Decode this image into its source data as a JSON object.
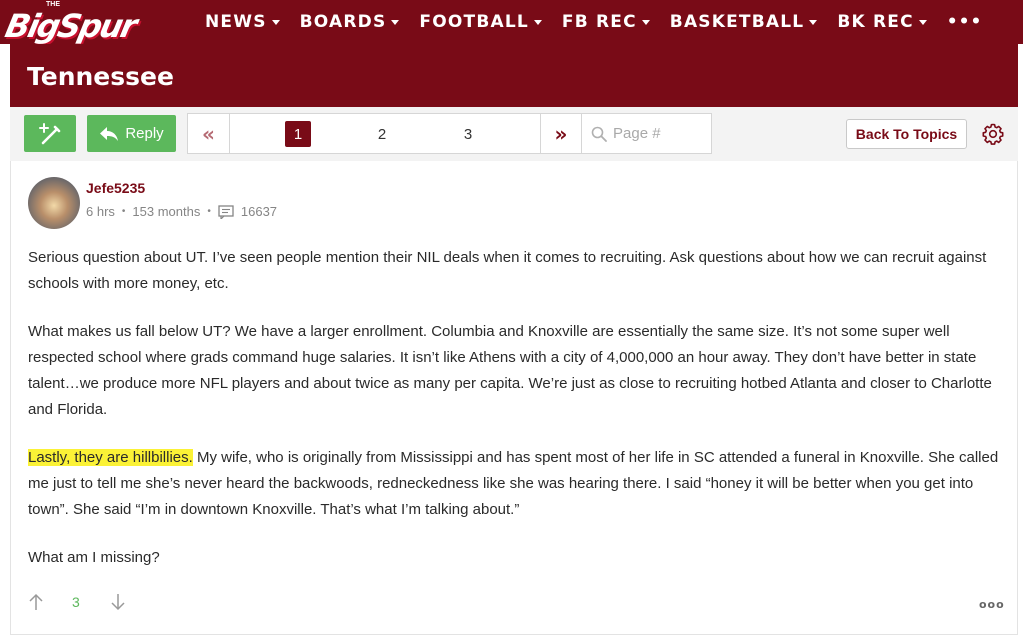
{
  "brand": {
    "logo_main": "BigSpur",
    "logo_the": "THE"
  },
  "nav": {
    "items": [
      {
        "label": "NEWS"
      },
      {
        "label": "BOARDS"
      },
      {
        "label": "FOOTBALL"
      },
      {
        "label": "FB REC"
      },
      {
        "label": "BASKETBALL"
      },
      {
        "label": "BK REC"
      }
    ],
    "more": "•••"
  },
  "page": {
    "title": "Tennessee"
  },
  "toolbar": {
    "new_topic_icon": "wand-plus-icon",
    "reply_label": "Reply",
    "pages": [
      "1",
      "2",
      "3"
    ],
    "current_page": "1",
    "page_placeholder": "Page #",
    "back_label": "Back To Topics",
    "settings_icon": "gear-icon"
  },
  "post": {
    "username": "Jefe5235",
    "time": "6 hrs",
    "tenure": "153 months",
    "post_count": "16637",
    "paragraphs": {
      "p1": "Serious question about UT. I’ve seen people mention their NIL deals when it comes to recruiting. Ask questions about how we can recruit against schools with more money, etc.",
      "p2": "What makes us fall below UT? We have a larger enrollment. Columbia and Knoxville are essentially the same size. It’s not some super well respected school where grads command huge salaries. It isn’t like Athens with a city of 4,000,000 an hour away. They don’t have better in state talent…we produce more NFL players and about twice as many per capita. We’re just as close to recruiting hotbed Atlanta and closer to Charlotte and Florida.",
      "p3_highlight": "Lastly, they are hillbillies.",
      "p3_rest": " My wife, who is originally from Mississippi and has spent most of her life in SC attended a funeral in Knoxville. She called me just to tell me she’s never heard the backwoods, redneckedness like she was hearing there. I said “honey it will be better when you get into town”. She said “I’m in downtown Knoxville. That’s what I’m talking about.”",
      "p4": "What am I missing?"
    },
    "votes": "3",
    "more": "ooo"
  },
  "colors": {
    "brand": "#790b17",
    "green": "#5cb85c",
    "highlight": "#fbf236"
  }
}
